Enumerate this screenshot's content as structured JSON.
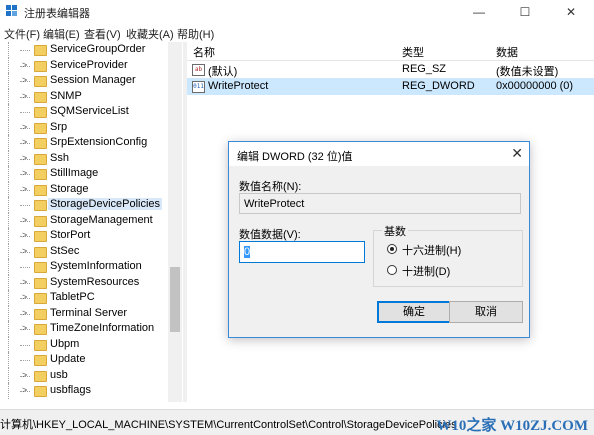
{
  "window": {
    "title": "注册表编辑器",
    "minimize": "—",
    "maximize": "☐",
    "close": "✕"
  },
  "menu": [
    "文件(F)",
    "编辑(E)",
    "查看(V)",
    "收藏夹(A)",
    "帮助(H)"
  ],
  "tree": {
    "items": [
      {
        "label": "ServiceGroupOrder",
        "expander": ""
      },
      {
        "label": "ServiceProvider",
        "expander": ">"
      },
      {
        "label": "Session Manager",
        "expander": ">"
      },
      {
        "label": "SNMP",
        "expander": ">"
      },
      {
        "label": "SQMServiceList",
        "expander": ""
      },
      {
        "label": "Srp",
        "expander": ">"
      },
      {
        "label": "SrpExtensionConfig",
        "expander": ">"
      },
      {
        "label": "Ssh",
        "expander": ">"
      },
      {
        "label": "StillImage",
        "expander": ">"
      },
      {
        "label": "Storage",
        "expander": ">"
      },
      {
        "label": "StorageDevicePolicies",
        "expander": ""
      },
      {
        "label": "StorageManagement",
        "expander": ">"
      },
      {
        "label": "StorPort",
        "expander": ">"
      },
      {
        "label": "StSec",
        "expander": ">"
      },
      {
        "label": "SystemInformation",
        "expander": ""
      },
      {
        "label": "SystemResources",
        "expander": ">"
      },
      {
        "label": "TabletPC",
        "expander": ">"
      },
      {
        "label": "Terminal Server",
        "expander": ">"
      },
      {
        "label": "TimeZoneInformation",
        "expander": ">"
      },
      {
        "label": "Ubpm",
        "expander": ""
      },
      {
        "label": "Update",
        "expander": ""
      },
      {
        "label": "usb",
        "expander": ">"
      },
      {
        "label": "usbflags",
        "expander": ">"
      }
    ],
    "selected_index": 10
  },
  "list": {
    "headers": {
      "name": "名称",
      "type": "类型",
      "data": "数据"
    },
    "rows": [
      {
        "icon": "ab",
        "name": "(默认)",
        "type": "REG_SZ",
        "data": "(数值未设置)"
      },
      {
        "icon": "011",
        "name": "WriteProtect",
        "type": "REG_DWORD",
        "data": "0x00000000 (0)"
      }
    ]
  },
  "status": {
    "path": "计算机\\HKEY_LOCAL_MACHINE\\SYSTEM\\CurrentControlSet\\Control\\StorageDevicePolicies",
    "watermark": "W10之家 W10ZJ.COM"
  },
  "dialog": {
    "title": "编辑 DWORD (32 位)值",
    "close": "✕",
    "value_name_label": "数值名称(N):",
    "value_name": "WriteProtect",
    "value_data_label": "数值数据(V):",
    "value_data": "0",
    "base_label": "基数",
    "radio_hex": "十六进制(H)",
    "radio_dec": "十进制(D)",
    "selected_base": "hex",
    "ok": "确定",
    "cancel": "取消"
  },
  "colors": {
    "accent": "#0078d7",
    "selection": "#cce8ff",
    "watermark": "#2a6fb6"
  }
}
